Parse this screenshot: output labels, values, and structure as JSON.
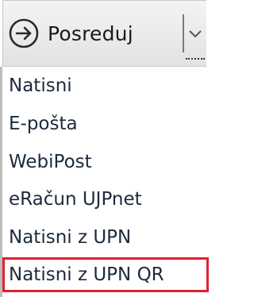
{
  "split_button": {
    "label": "Posreduj",
    "icon": "arrow-right-circle-icon",
    "caret_icon": "chevron-down-icon"
  },
  "menu": {
    "items": [
      {
        "label": "Natisni"
      },
      {
        "label": "E-pošta"
      },
      {
        "label": "WebiPost"
      },
      {
        "label": "eRačun UJPnet"
      },
      {
        "label": "Natisni z UPN"
      },
      {
        "label": "Natisni z UPN QR",
        "highlighted": true
      }
    ],
    "highlight_color": "#e0202e"
  }
}
